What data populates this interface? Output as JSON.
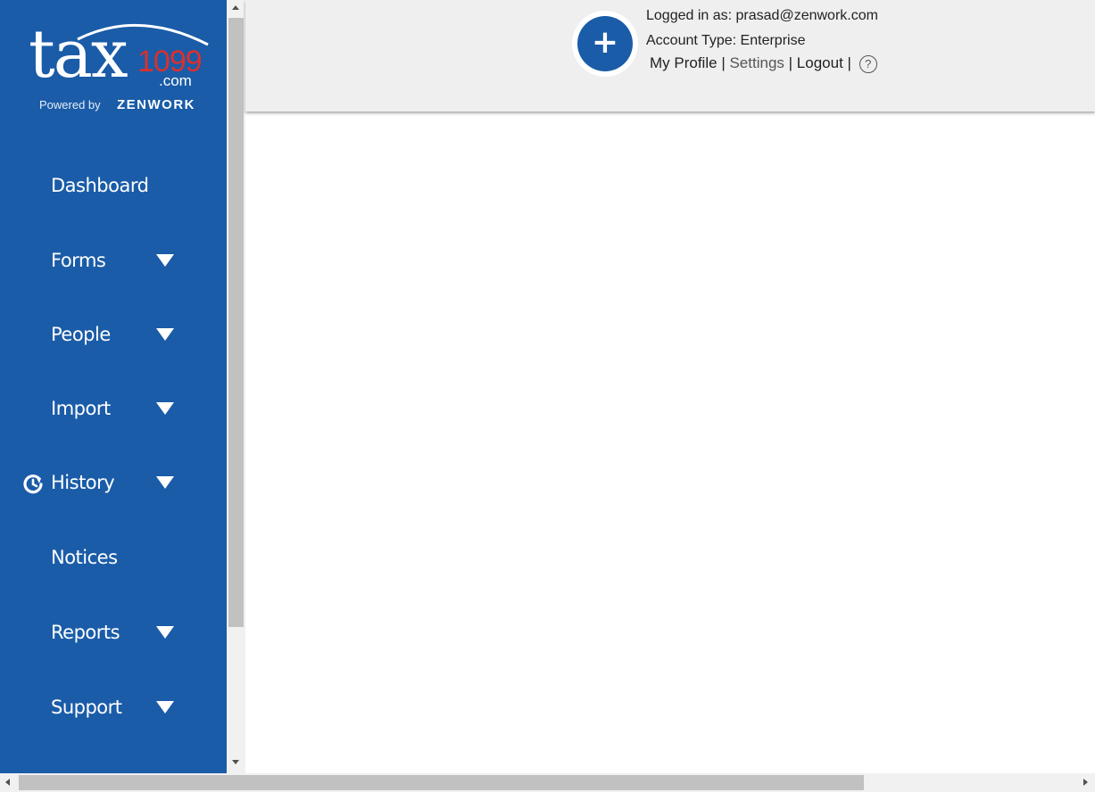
{
  "logo": {
    "brand": "tax",
    "brand_number": "1099",
    "brand_suffix": ".com",
    "powered_by": "Powered by",
    "partner": "ZENWORK"
  },
  "sidebar": {
    "items": [
      {
        "label": "Dashboard",
        "has_dropdown": false
      },
      {
        "label": "Forms",
        "has_dropdown": true
      },
      {
        "label": "People",
        "has_dropdown": true
      },
      {
        "label": "Import",
        "has_dropdown": true
      },
      {
        "label": "History",
        "has_dropdown": true,
        "icon": "history-icon"
      },
      {
        "label": "Notices",
        "has_dropdown": false
      },
      {
        "label": "Reports",
        "has_dropdown": true
      },
      {
        "label": "Support",
        "has_dropdown": true
      }
    ]
  },
  "header": {
    "add_button_symbol": "+",
    "logged_in_as": "Logged in as: prasad@zenwork.com",
    "account_type": "Account Type: Enterprise",
    "links": {
      "my_profile": "My Profile",
      "settings": "Settings",
      "logout": "Logout",
      "separator": "|",
      "help_symbol": "?"
    }
  },
  "colors": {
    "sidebar_bg": "#1a5ca8",
    "header_bg": "#efefef",
    "brand_red": "#d9302e"
  }
}
